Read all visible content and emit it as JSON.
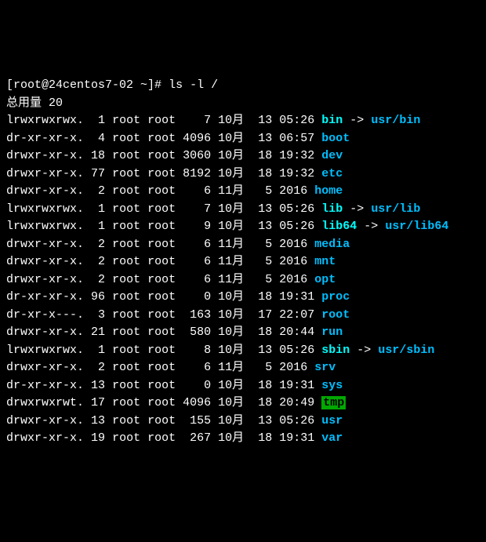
{
  "prompt": {
    "user_host": "[root@24centos7-02 ~]#",
    "command": "ls -l /"
  },
  "total_line": "总用量 20",
  "rows": [
    {
      "perms": "lrwxrwxrwx.",
      "links": "1",
      "owner": "root",
      "group": "root",
      "size": "7",
      "month": "10月",
      "day": "13",
      "time": "05:26",
      "name": "bin",
      "arrow": "->",
      "target": "usr/bin",
      "type": "link"
    },
    {
      "perms": "dr-xr-xr-x.",
      "links": "4",
      "owner": "root",
      "group": "root",
      "size": "4096",
      "month": "10月",
      "day": "13",
      "time": "06:57",
      "name": "boot",
      "type": "dir"
    },
    {
      "perms": "drwxr-xr-x.",
      "links": "18",
      "owner": "root",
      "group": "root",
      "size": "3060",
      "month": "10月",
      "day": "18",
      "time": "19:32",
      "name": "dev",
      "type": "dir"
    },
    {
      "perms": "drwxr-xr-x.",
      "links": "77",
      "owner": "root",
      "group": "root",
      "size": "8192",
      "month": "10月",
      "day": "18",
      "time": "19:32",
      "name": "etc",
      "type": "dir"
    },
    {
      "perms": "drwxr-xr-x.",
      "links": "2",
      "owner": "root",
      "group": "root",
      "size": "6",
      "month": "11月",
      "day": "5",
      "time": "2016",
      "name": "home",
      "type": "dir"
    },
    {
      "perms": "lrwxrwxrwx.",
      "links": "1",
      "owner": "root",
      "group": "root",
      "size": "7",
      "month": "10月",
      "day": "13",
      "time": "05:26",
      "name": "lib",
      "arrow": "->",
      "target": "usr/lib",
      "type": "link"
    },
    {
      "perms": "lrwxrwxrwx.",
      "links": "1",
      "owner": "root",
      "group": "root",
      "size": "9",
      "month": "10月",
      "day": "13",
      "time": "05:26",
      "name": "lib64",
      "arrow": "->",
      "target": "usr/lib64",
      "type": "link"
    },
    {
      "perms": "drwxr-xr-x.",
      "links": "2",
      "owner": "root",
      "group": "root",
      "size": "6",
      "month": "11月",
      "day": "5",
      "time": "2016",
      "name": "media",
      "type": "dir"
    },
    {
      "perms": "drwxr-xr-x.",
      "links": "2",
      "owner": "root",
      "group": "root",
      "size": "6",
      "month": "11月",
      "day": "5",
      "time": "2016",
      "name": "mnt",
      "type": "dir"
    },
    {
      "perms": "drwxr-xr-x.",
      "links": "2",
      "owner": "root",
      "group": "root",
      "size": "6",
      "month": "11月",
      "day": "5",
      "time": "2016",
      "name": "opt",
      "type": "dir"
    },
    {
      "perms": "dr-xr-xr-x.",
      "links": "96",
      "owner": "root",
      "group": "root",
      "size": "0",
      "month": "10月",
      "day": "18",
      "time": "19:31",
      "name": "proc",
      "type": "dir"
    },
    {
      "perms": "dr-xr-x---.",
      "links": "3",
      "owner": "root",
      "group": "root",
      "size": "163",
      "month": "10月",
      "day": "17",
      "time": "22:07",
      "name": "root",
      "type": "dir"
    },
    {
      "perms": "drwxr-xr-x.",
      "links": "21",
      "owner": "root",
      "group": "root",
      "size": "580",
      "month": "10月",
      "day": "18",
      "time": "20:44",
      "name": "run",
      "type": "dir"
    },
    {
      "perms": "lrwxrwxrwx.",
      "links": "1",
      "owner": "root",
      "group": "root",
      "size": "8",
      "month": "10月",
      "day": "13",
      "time": "05:26",
      "name": "sbin",
      "arrow": "->",
      "target": "usr/sbin",
      "type": "link"
    },
    {
      "perms": "drwxr-xr-x.",
      "links": "2",
      "owner": "root",
      "group": "root",
      "size": "6",
      "month": "11月",
      "day": "5",
      "time": "2016",
      "name": "srv",
      "type": "dir"
    },
    {
      "perms": "dr-xr-xr-x.",
      "links": "13",
      "owner": "root",
      "group": "root",
      "size": "0",
      "month": "10月",
      "day": "18",
      "time": "19:31",
      "name": "sys",
      "type": "dir"
    },
    {
      "perms": "drwxrwxrwt.",
      "links": "17",
      "owner": "root",
      "group": "root",
      "size": "4096",
      "month": "10月",
      "day": "18",
      "time": "20:49",
      "name": "tmp",
      "type": "tmp"
    },
    {
      "perms": "drwxr-xr-x.",
      "links": "13",
      "owner": "root",
      "group": "root",
      "size": "155",
      "month": "10月",
      "day": "13",
      "time": "05:26",
      "name": "usr",
      "type": "dir"
    },
    {
      "perms": "drwxr-xr-x.",
      "links": "19",
      "owner": "root",
      "group": "root",
      "size": "267",
      "month": "10月",
      "day": "18",
      "time": "19:31",
      "name": "var",
      "type": "dir"
    }
  ]
}
